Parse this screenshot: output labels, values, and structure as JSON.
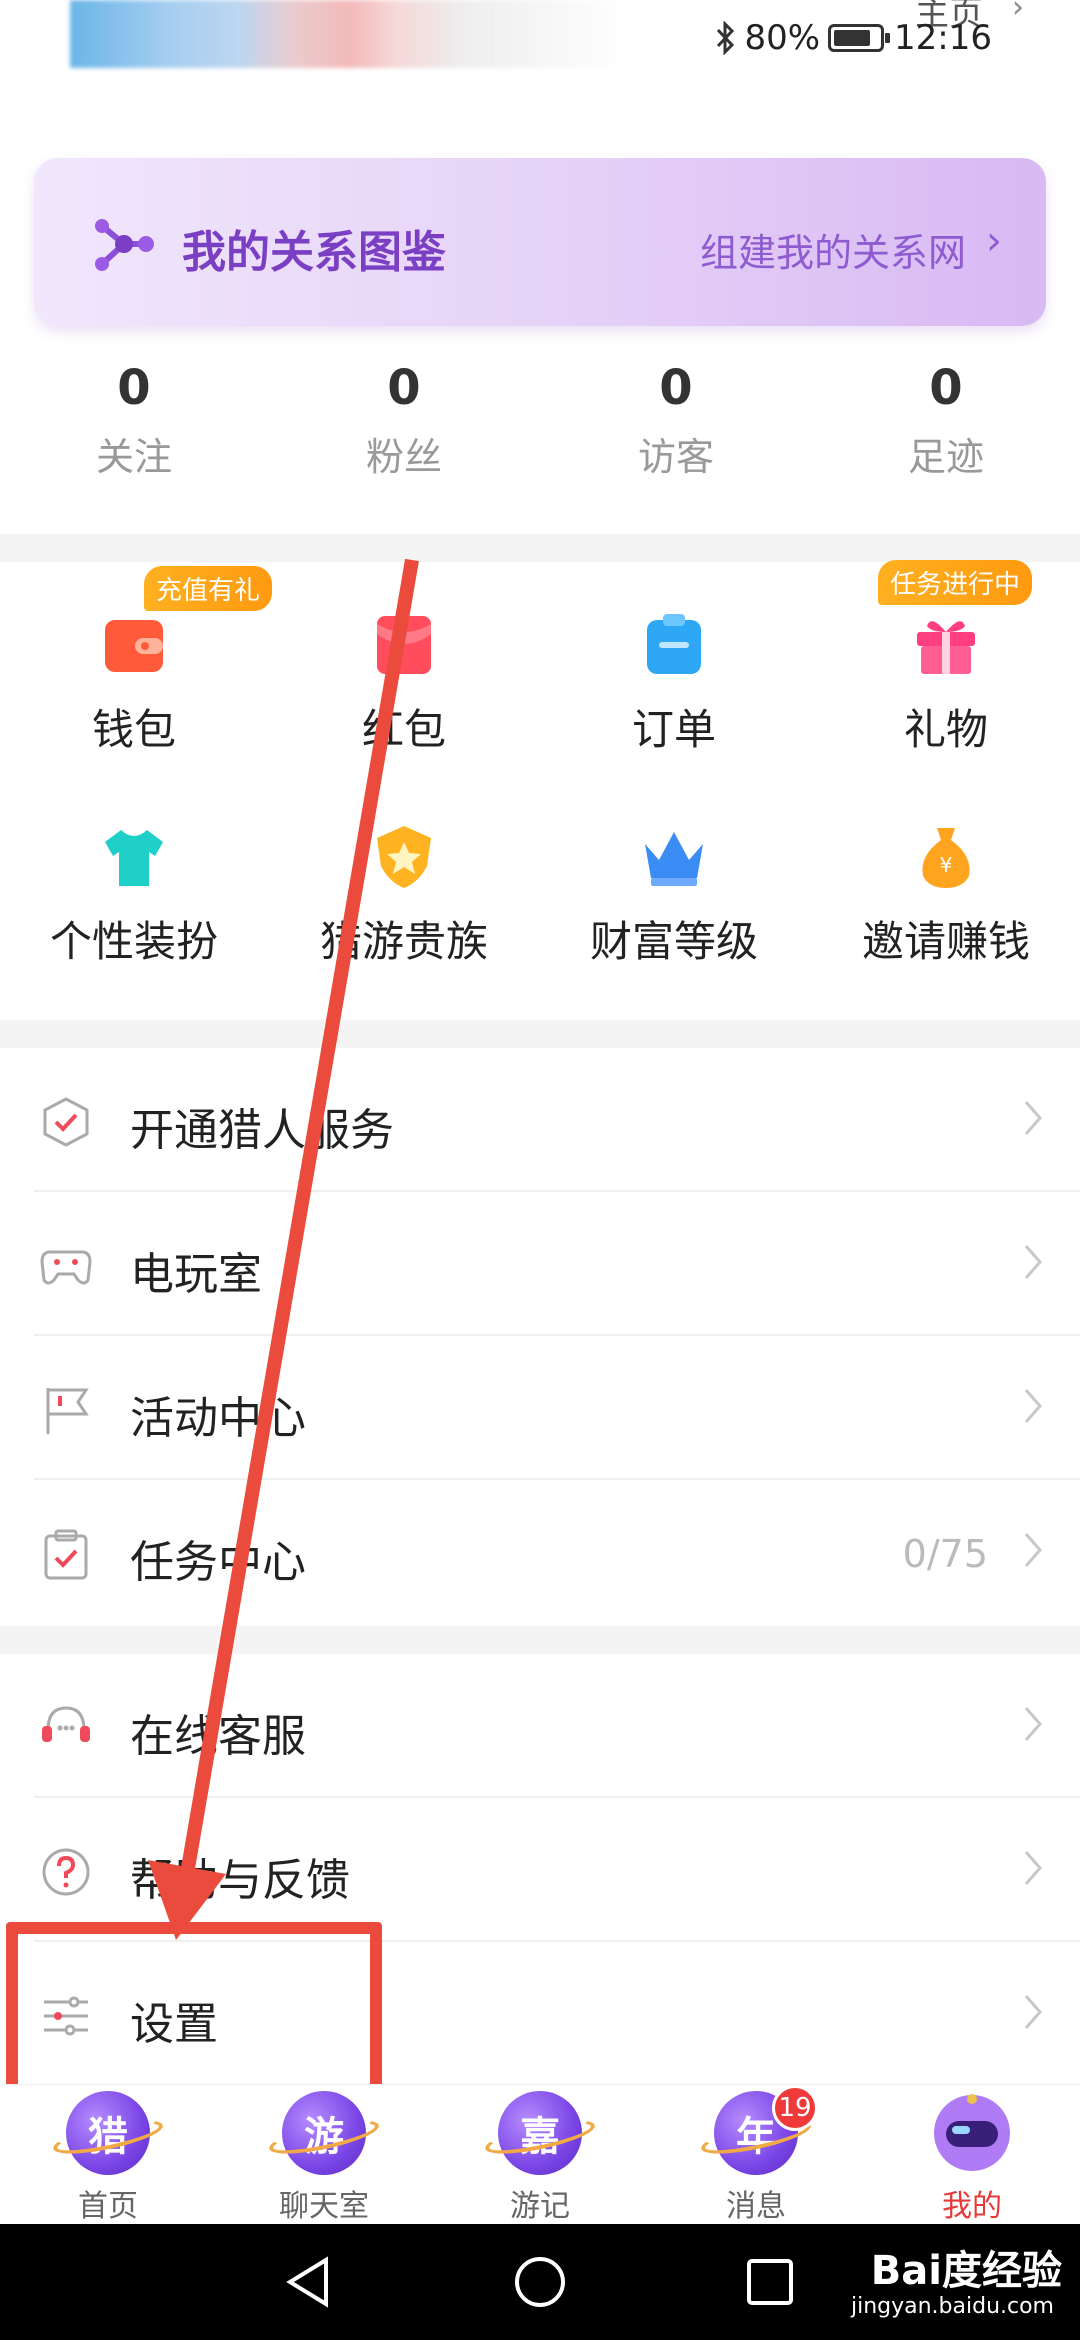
{
  "status_bar": {
    "page_link": "主页",
    "battery": "80%",
    "time": "12:16"
  },
  "banner": {
    "title": "我的关系图鉴",
    "link": "组建我的关系网"
  },
  "stats": [
    {
      "value": "0",
      "label": "关注"
    },
    {
      "value": "0",
      "label": "粉丝"
    },
    {
      "value": "0",
      "label": "访客"
    },
    {
      "value": "0",
      "label": "足迹"
    }
  ],
  "grid": [
    {
      "label": "钱包",
      "icon": "wallet-icon",
      "badge": "充值有礼"
    },
    {
      "label": "红包",
      "icon": "red-envelope-icon"
    },
    {
      "label": "订单",
      "icon": "order-icon"
    },
    {
      "label": "礼物",
      "icon": "gift-icon",
      "badge": "任务进行中"
    },
    {
      "label": "个性装扮",
      "icon": "tshirt-icon"
    },
    {
      "label": "猎游贵族",
      "icon": "noble-shield-icon"
    },
    {
      "label": "财富等级",
      "icon": "crown-icon"
    },
    {
      "label": "邀请赚钱",
      "icon": "money-bag-icon"
    }
  ],
  "menu_group_1": [
    {
      "label": "开通猎人服务",
      "icon": "shield-check-icon"
    },
    {
      "label": "电玩室",
      "icon": "gamepad-icon"
    },
    {
      "label": "活动中心",
      "icon": "flag-icon"
    },
    {
      "label": "任务中心",
      "icon": "clipboard-check-icon",
      "extra": "0/75"
    }
  ],
  "menu_group_2": [
    {
      "label": "在线客服",
      "icon": "headset-icon"
    },
    {
      "label": "帮助与反馈",
      "icon": "question-icon"
    },
    {
      "label": "设置",
      "icon": "sliders-icon"
    }
  ],
  "bottom_nav": [
    {
      "label": "首页",
      "glyph": "猎"
    },
    {
      "label": "聊天室",
      "glyph": "游"
    },
    {
      "label": "游记",
      "glyph": "嘉"
    },
    {
      "label": "消息",
      "glyph": "年",
      "badge": "19"
    },
    {
      "label": "我的",
      "active": true
    }
  ],
  "watermark": {
    "brand": "Bai度经验",
    "url": "jingyan.baidu.com"
  },
  "colors": {
    "accent_purple": "#7a3fc3",
    "highlight_red": "#ea4b3c",
    "active_tab": "#e63a3a",
    "badge_orange": "#ff9a10"
  }
}
